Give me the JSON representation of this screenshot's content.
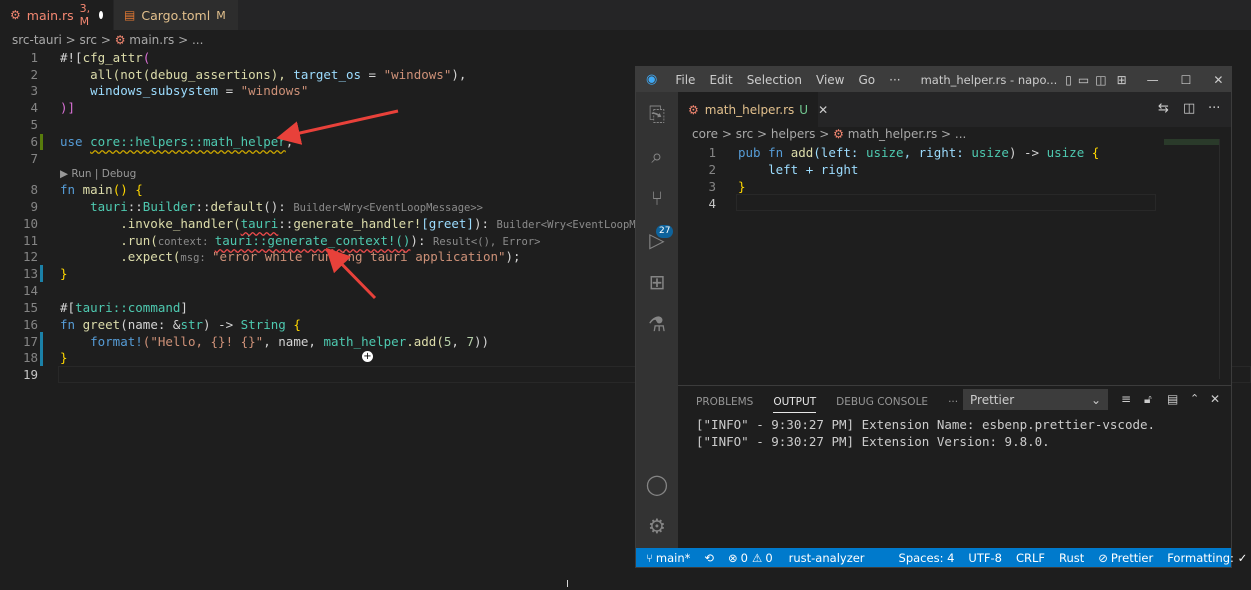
{
  "tabs": [
    {
      "icon": "rust-gear-icon",
      "label": "main.rs",
      "status": "3, M"
    },
    {
      "icon": "file-icon",
      "label": "Cargo.toml",
      "status": "M"
    }
  ],
  "breadcrumb": {
    "p1": "src-tauri",
    "p2": "src",
    "p3": "main.rs",
    "p4": "..."
  },
  "codelens": "▶ Run | Debug",
  "line_numbers": [
    "1",
    "2",
    "3",
    "4",
    "5",
    "6",
    "7",
    "8",
    "9",
    "10",
    "11",
    "12",
    "13",
    "14",
    "15",
    "16",
    "17",
    "18",
    "19"
  ],
  "code": {
    "l1a": "#![",
    "l1b": "cfg_attr",
    "l1c": "(",
    "l2a": "    all(not(debug_assertions), ",
    "l2b": "target_os",
    "l2c": " = ",
    "l2d": "\"windows\"",
    "l2e": "),",
    "l3a": "    windows_subsystem",
    "l3b": " = ",
    "l3c": "\"windows\"",
    "l4": ")]",
    "l6a": "use ",
    "l6b": "core::helpers::math_helper",
    "l6c": ";",
    "l8a": "fn ",
    "l8b": "main",
    "l8c": "() {",
    "l9a": "    tauri",
    "l9b": "::",
    "l9c": "Builder",
    "l9d": "::",
    "l9e": "default",
    "l9f": "(): ",
    "l9hint": "Builder<Wry<EventLoopMessage>>",
    "l10a": "        .invoke_handler(",
    "l10b": "tauri",
    "l10c": "::",
    "l10d": "generate_handler!",
    "l10e": "[greet]",
    "l10f": "): ",
    "l10hint": "Builder<Wry<EventLoopMessage>>",
    "l11a": "        .run(",
    "l11hint1": "context: ",
    "l11b": "tauri::generate_context!()",
    "l11c": "): ",
    "l11hint2": "Result<(), Error>",
    "l12a": "        .expect(",
    "l12hint": "msg: ",
    "l12b": "\"error while running tauri application\"",
    "l12c": ");",
    "l13": "}",
    "l15a": "#[",
    "l15b": "tauri::command",
    "l15c": "]",
    "l16a": "fn ",
    "l16b": "greet",
    "l16c": "(name: &",
    "l16d": "str",
    "l16e": ") -> ",
    "l16f": "String",
    "l16g": " {",
    "l17a": "    format!",
    "l17b": "(\"Hello, {}! {}\"",
    "l17c": ", name, ",
    "l17d": "math_helper",
    "l17e": ".add(",
    "l17f": "5",
    "l17g": ", ",
    "l17h": "7",
    "l17i": "))",
    "l18": "}"
  },
  "window": {
    "menu": [
      "File",
      "Edit",
      "Selection",
      "View",
      "Go",
      "···"
    ],
    "title": "math_helper.rs - napo...",
    "tab_label": "math_helper.rs",
    "tab_status": "U",
    "breadcrumb": {
      "p1": "core",
      "p2": "src",
      "p3": "helpers",
      "p4": "math_helper.rs",
      "p5": "..."
    },
    "line_numbers": [
      "1",
      "2",
      "3",
      "4"
    ],
    "code": {
      "w1a": "pub ",
      "w1b": "fn ",
      "w1c": "add",
      "w1d": "(left: ",
      "w1e": "usize",
      "w1f": ", right: ",
      "w1g": "usize",
      "w1h": ") -> ",
      "w1i": "usize",
      "w1j": " {",
      "w2": "    left + right",
      "w3": "}"
    },
    "source_control_badge": "27",
    "panel": {
      "tabs": [
        "PROBLEMS",
        "OUTPUT",
        "DEBUG CONSOLE",
        "···"
      ],
      "dropdown": "Prettier",
      "output": [
        "[\"INFO\" - 9:30:27 PM] Extension Name: esbenp.prettier-vscode.",
        "[\"INFO\" - 9:30:27 PM] Extension Version: 9.8.0."
      ]
    },
    "status": {
      "branch": "main*",
      "errors": "0",
      "warnings": "0",
      "analyzer": "rust-analyzer",
      "spaces": "Spaces: 4",
      "encoding": "UTF-8",
      "eol": "CRLF",
      "language": "Rust",
      "prettier": "Prettier",
      "formatting": "Formatting: ✓"
    }
  }
}
